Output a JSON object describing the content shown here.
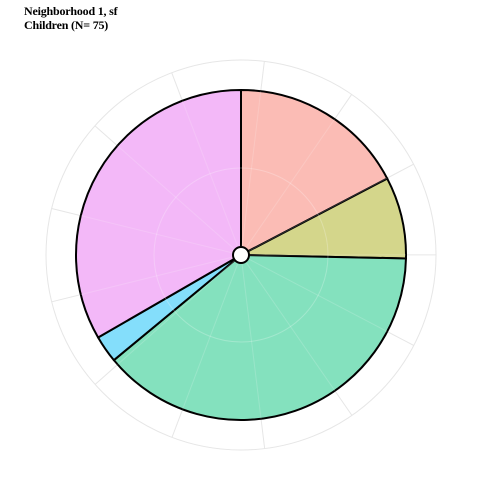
{
  "chart_data": {
    "type": "pie",
    "title": "Neighborhood 1, sf",
    "subtitle": "Children (N= 75)",
    "slices": [
      {
        "value": 13,
        "color": "#fbb8b1"
      },
      {
        "value": 6,
        "color": "#d2d485"
      },
      {
        "value": 29,
        "color": "#7ddfbb"
      },
      {
        "value": 2,
        "color": "#7ddcfb"
      },
      {
        "value": 25,
        "color": "#f2b4f8"
      }
    ],
    "total": 75,
    "grid": true,
    "legend": "none"
  },
  "colors": {
    "grid": "#e6e6e6",
    "outline": "#000000",
    "background": "#ffffff"
  }
}
